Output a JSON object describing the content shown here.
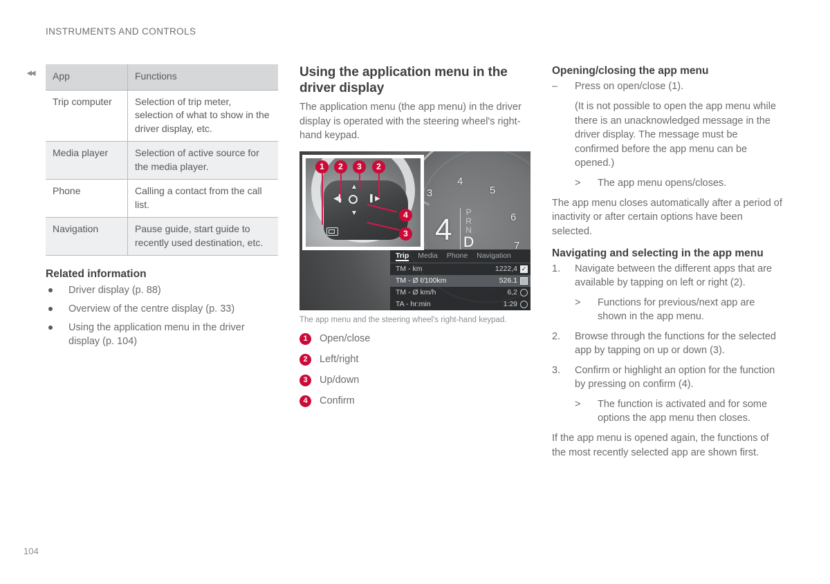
{
  "page": {
    "running_header": "INSTRUMENTS AND CONTROLS",
    "page_number": "104",
    "edge_marker": "◂◂"
  },
  "table": {
    "headers": [
      "App",
      "Functions"
    ],
    "rows": [
      {
        "app": "Trip computer",
        "functions": "Selection of trip meter, selection of what to show in the driver display, etc."
      },
      {
        "app": "Media player",
        "functions": "Selection of active source for the media player."
      },
      {
        "app": "Phone",
        "functions": "Calling a contact from the call list."
      },
      {
        "app": "Navigation",
        "functions": "Pause guide, start guide to recently used destination, etc."
      }
    ]
  },
  "related": {
    "heading": "Related information",
    "items": [
      "Driver display (p. 88)",
      "Overview of the centre display (p. 33)",
      "Using the application menu in the driver display (p. 104)"
    ]
  },
  "middle": {
    "heading": "Using the application menu in the driver display",
    "intro": "The application menu (the app menu) in the driver display is operated with the steering wheel's right-hand keypad.",
    "caption": "The app menu and the steering wheel's right-hand keypad.",
    "legend": [
      {
        "num": "1",
        "label": "Open/close"
      },
      {
        "num": "2",
        "label": "Left/right"
      },
      {
        "num": "3",
        "label": "Up/down"
      },
      {
        "num": "4",
        "label": "Confirm"
      }
    ]
  },
  "illustration": {
    "callouts": [
      "1",
      "2",
      "3",
      "2",
      "4",
      "3"
    ],
    "gauge": {
      "tick_labels": [
        "3",
        "4",
        "5",
        "6",
        "7"
      ],
      "gear_number": "4",
      "prnd": [
        "P",
        "R",
        "N",
        "D"
      ],
      "prnd_active": "D"
    },
    "app_menu": {
      "tabs": [
        "Trip",
        "Media",
        "Phone",
        "Navigation"
      ],
      "active_tab": "Trip",
      "rows": [
        {
          "label": "TM - km",
          "value": "1222,4",
          "control": "checked"
        },
        {
          "label": "TM - Ø ℓ/100km",
          "value": "526.1",
          "control": "box"
        },
        {
          "label": "TM - Ø km/h",
          "value": "6,2",
          "control": "radio"
        },
        {
          "label": "TA - hr:min",
          "value": "1:29",
          "control": "radio"
        }
      ],
      "highlighted_row_index": 1
    }
  },
  "right": {
    "open_close": {
      "heading": "Opening/closing the app menu",
      "step_marker": "–",
      "step_text": "Press on open/close (1).",
      "note": "(It is not possible to open the app menu while there is an unacknowledged message in the driver display. The message must be confirmed before the app menu can be opened.)",
      "result_marker": ">",
      "result_text": "The app menu opens/closes.",
      "paragraph": "The app menu closes automatically after a period of inactivity or after certain options have been selected."
    },
    "navigating": {
      "heading": "Navigating and selecting in the app menu",
      "steps": [
        {
          "marker": "1.",
          "text": "Navigate between the different apps that are available by tapping on left or right (2).",
          "result_marker": ">",
          "result": "Functions for previous/next app are shown in the app menu."
        },
        {
          "marker": "2.",
          "text": "Browse through the functions for the selected app by tapping on up or down (3).",
          "result_marker": "",
          "result": ""
        },
        {
          "marker": "3.",
          "text": "Confirm or highlight an option for the function by pressing on confirm (4).",
          "result_marker": ">",
          "result": "The function is activated and for some options the app menu then closes."
        }
      ],
      "closing_paragraph": "If the app menu is opened again, the functions of the most recently selected app are shown first."
    }
  },
  "colors": {
    "accent_red": "#cb0a38",
    "leader_red": "#d9174b",
    "table_header_bg": "#d6d7d8",
    "table_shaded_bg": "#eeeff0",
    "body_text": "#6a6b6d",
    "heading_text": "#404041"
  }
}
